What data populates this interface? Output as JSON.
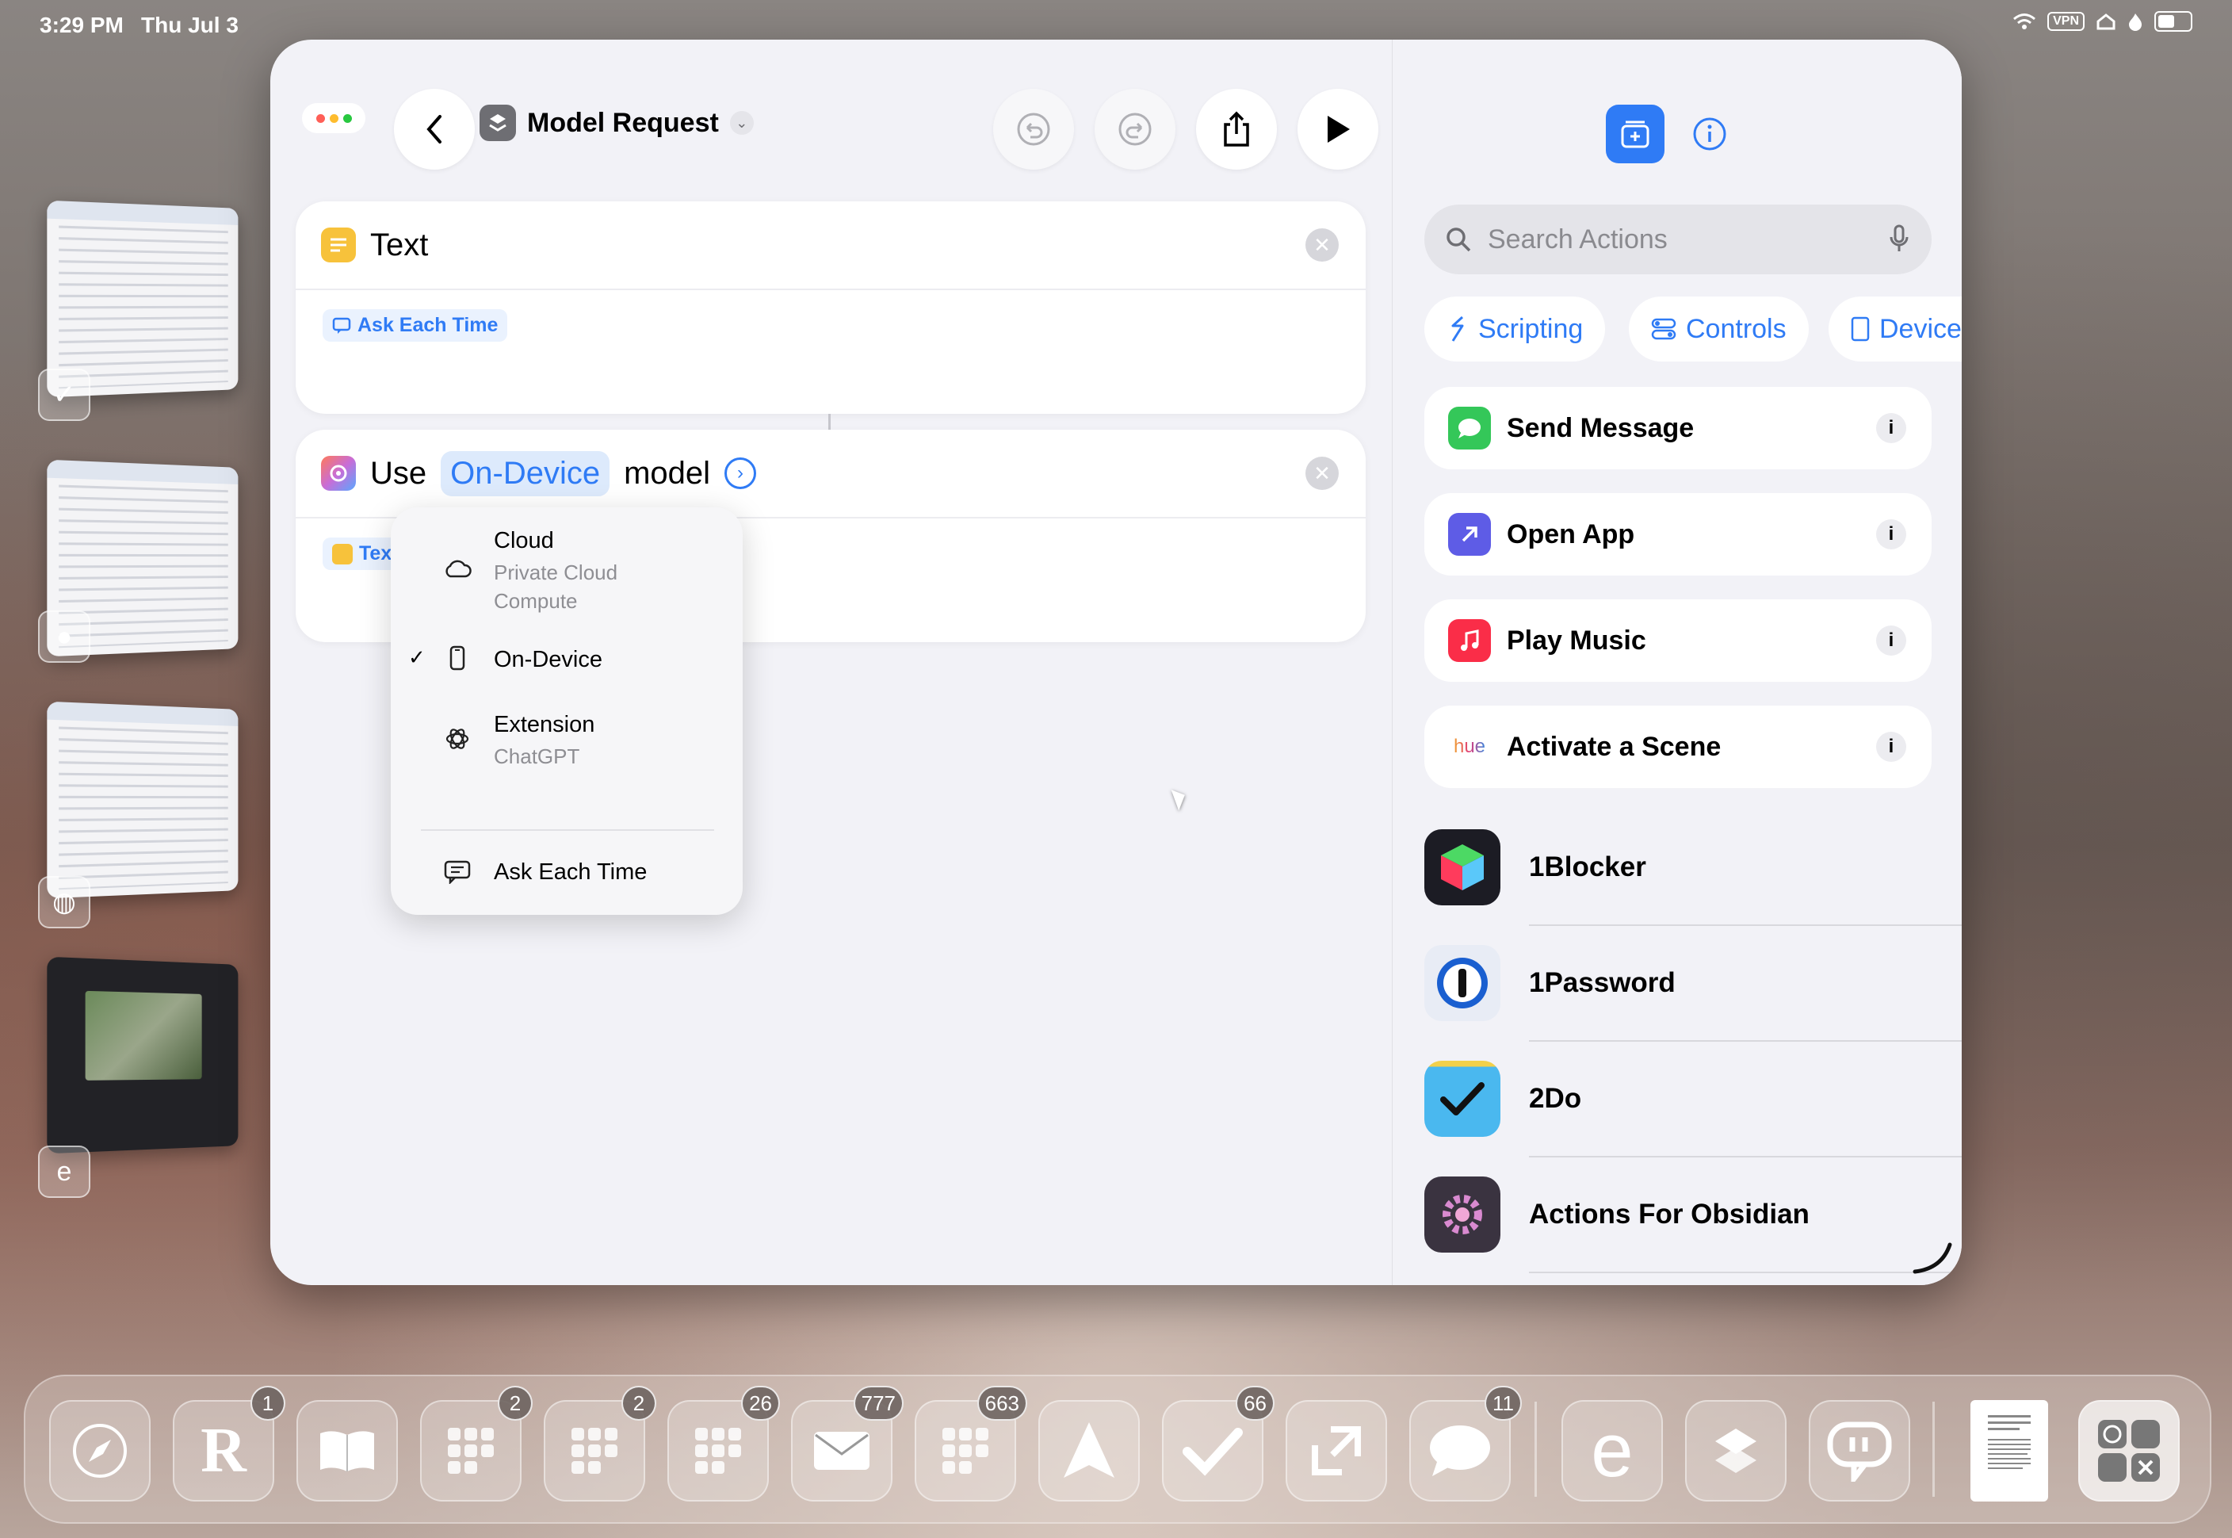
{
  "status_bar": {
    "time": "3:29 PM",
    "date": "Thu Jul 3",
    "vpn": "VPN"
  },
  "toolbar": {
    "title": "Model Request"
  },
  "text_card": {
    "title": "Text",
    "token": "Ask Each Time"
  },
  "model_card": {
    "word_use": "Use",
    "model_value": "On-Device",
    "word_model": "model",
    "token": "Text"
  },
  "model_menu": {
    "items": [
      {
        "label": "Cloud",
        "sub1": "Private Cloud",
        "sub2": "Compute",
        "icon": "cloud-icon",
        "checked": false
      },
      {
        "label": "On-Device",
        "icon": "iphone-icon",
        "checked": true
      },
      {
        "label": "Extension",
        "sub1": "ChatGPT",
        "icon": "chatgpt-icon",
        "checked": false
      },
      {
        "label": "Ask Each Time",
        "icon": "message-icon",
        "checked": false
      }
    ],
    "checkmark": "✓"
  },
  "sidebar": {
    "search_placeholder": "Search Actions",
    "chips": [
      "Scripting",
      "Controls",
      "Device"
    ],
    "suggested": [
      {
        "label": "Send Message",
        "icon": "messages-icon",
        "color": "#34c759"
      },
      {
        "label": "Open App",
        "icon": "open-app-icon",
        "color": "#5e5ce6"
      },
      {
        "label": "Play Music",
        "icon": "music-icon",
        "color": "#fa2d48"
      },
      {
        "label": "Activate a Scene",
        "icon": "hue-icon",
        "color": "#ffffff",
        "brand": "hue"
      }
    ],
    "apps": [
      {
        "label": "1Blocker",
        "icon": "1blocker-icon"
      },
      {
        "label": "1Password",
        "icon": "1password-icon"
      },
      {
        "label": "2Do",
        "icon": "2do-icon"
      },
      {
        "label": "Actions For Obsidian",
        "icon": "obsidian-actions-icon"
      }
    ],
    "info_glyph": "i"
  },
  "dock": {
    "apps": [
      {
        "name": "Safari",
        "icon": "safari-icon",
        "badge": ""
      },
      {
        "name": "Reeder",
        "icon": "reeder-icon",
        "badge": "1",
        "glyph": "R"
      },
      {
        "name": "Books",
        "icon": "books-icon",
        "badge": ""
      },
      {
        "name": "Folder 1",
        "icon": "folder-icon",
        "badge": "2"
      },
      {
        "name": "Folder 2",
        "icon": "folder-icon",
        "badge": "2"
      },
      {
        "name": "Folder 3",
        "icon": "folder-icon",
        "badge": "26"
      },
      {
        "name": "Mail",
        "icon": "mail-icon",
        "badge": "777"
      },
      {
        "name": "Folder 4",
        "icon": "folder-icon",
        "badge": "663"
      },
      {
        "name": "Spark",
        "icon": "paper-plane-icon",
        "badge": ""
      },
      {
        "name": "Things",
        "icon": "checkmark-icon",
        "badge": "66"
      },
      {
        "name": "Resize",
        "icon": "resize-icon",
        "badge": ""
      },
      {
        "name": "Messages",
        "icon": "messages-icon",
        "badge": "11"
      },
      {
        "name": "Edge",
        "icon": "edge-icon",
        "badge": "",
        "glyph": "e"
      },
      {
        "name": "Shortcuts",
        "icon": "shortcuts-icon",
        "badge": ""
      },
      {
        "name": "Chat",
        "icon": "chat-bubble-icon",
        "badge": ""
      },
      {
        "name": "Document",
        "icon": "document-icon",
        "badge": ""
      },
      {
        "name": "Utilities",
        "icon": "folder-icon",
        "badge": ""
      }
    ]
  },
  "colors": {
    "accent": "#2f7bf5",
    "text_icon": "#f7c23b"
  }
}
